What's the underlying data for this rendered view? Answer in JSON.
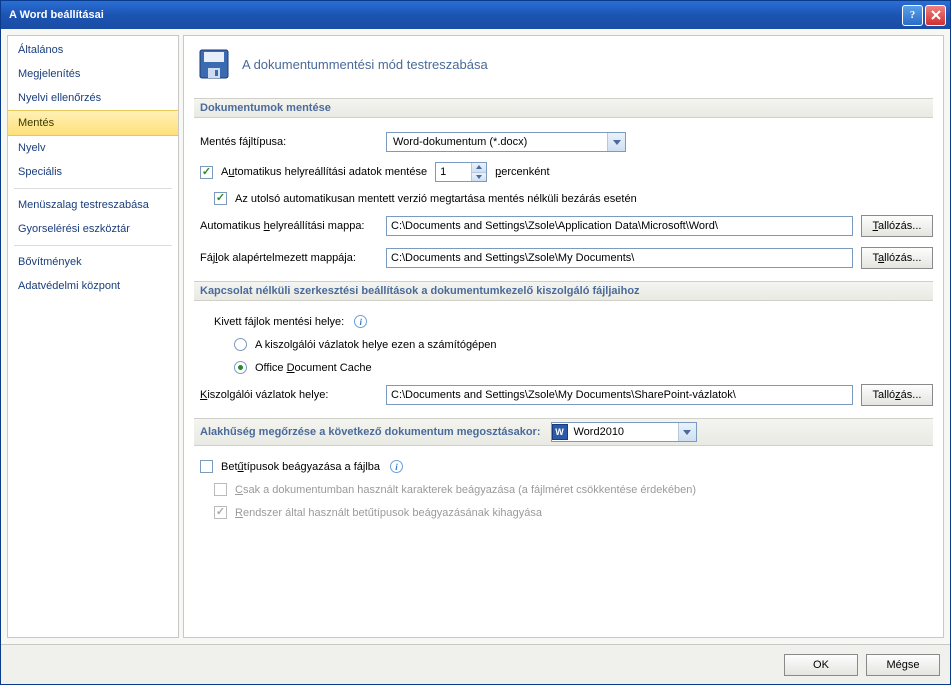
{
  "window": {
    "title": "A Word beállításai"
  },
  "sidebar": {
    "items": [
      {
        "label": "Általános"
      },
      {
        "label": "Megjelenítés"
      },
      {
        "label": "Nyelvi ellenőrzés"
      },
      {
        "label": "Mentés",
        "selected": true
      },
      {
        "label": "Nyelv"
      },
      {
        "label": "Speciális"
      }
    ],
    "items2": [
      {
        "label": "Menüszalag testreszabása"
      },
      {
        "label": "Gyorselérési eszköztár"
      }
    ],
    "items3": [
      {
        "label": "Bővítmények"
      },
      {
        "label": "Adatvédelmi központ"
      }
    ]
  },
  "header": {
    "title": "A dokumentummentési mód testreszabása"
  },
  "save_docs": {
    "heading": "Dokumentumok mentése",
    "file_type_label": "Mentés fájltípusa:",
    "file_type_value": "Word-dokumentum (*.docx)",
    "autosave_prefix": "Automatikus helyreállítási adatok mentése",
    "autosave_value": "1",
    "autosave_suffix": "percenként",
    "keep_last": "Az utolsó automatikusan mentett verzió megtartása mentés nélküli bezárás esetén",
    "autorecover_folder_label": "Automatikus helyreállítási mappa:",
    "autorecover_folder_value": "C:\\Documents and Settings\\Zsole\\Application Data\\Microsoft\\Word\\",
    "default_folder_label": "Fájlok alapértelmezett mappája:",
    "default_folder_value": "C:\\Documents and Settings\\Zsole\\My Documents\\",
    "browse": "Tallózás..."
  },
  "offline": {
    "heading": "Kapcsolat nélküli szerkesztési beállítások a dokumentumkezelő kiszolgáló fájljaihoz",
    "checkout_label": "Kivett fájlok mentési helye:",
    "radio_server": "A kiszolgálói vázlatok helye ezen a számítógépen",
    "radio_cache": "Office Document Cache",
    "drafts_label": "Kiszolgálói vázlatok helye:",
    "drafts_value": "C:\\Documents and Settings\\Zsole\\My Documents\\SharePoint-vázlatok\\",
    "browse": "Tallózás..."
  },
  "fidelity": {
    "heading": "Alakhűség megőrzése a következő dokumentum megosztásakor:",
    "doc_value": "Word2010",
    "embed_fonts": "Betűtípusok beágyazása a fájlba",
    "embed_used": "Csak a dokumentumban használt karakterek beágyazása (a fájlméret csökkentése érdekében)",
    "skip_system": "Rendszer által használt betűtípusok beágyazásának kihagyása"
  },
  "footer": {
    "ok": "OK",
    "cancel": "Mégse"
  }
}
